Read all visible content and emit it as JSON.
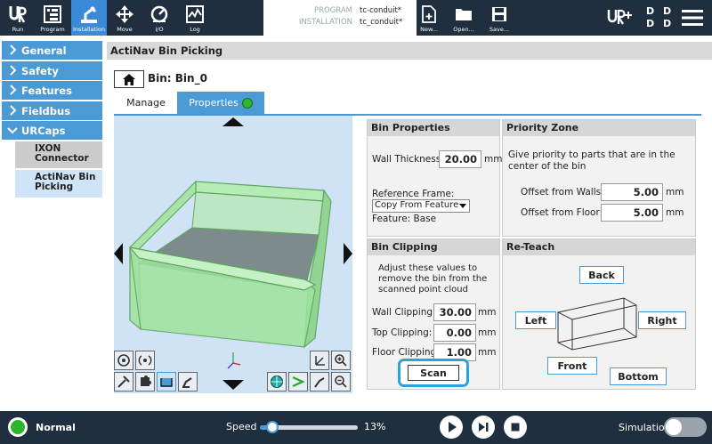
{
  "topbar": {
    "nav": [
      {
        "label": "Run",
        "icon": "ur-logo-icon"
      },
      {
        "label": "Program",
        "icon": "program-icon"
      },
      {
        "label": "Installation",
        "icon": "installation-icon"
      },
      {
        "label": "Move",
        "icon": "move-icon"
      },
      {
        "label": "I/O",
        "icon": "io-icon"
      },
      {
        "label": "Log",
        "icon": "log-icon"
      }
    ],
    "program_key": "PROGRAM",
    "program_value": "tc-conduit*",
    "installation_key": "INSTALLATION",
    "installation_value": "tc_conduit*",
    "file_buttons": [
      {
        "label": "New...",
        "icon": "new-file-icon"
      },
      {
        "label": "Open...",
        "icon": "open-folder-icon"
      },
      {
        "label": "Save...",
        "icon": "save-icon"
      }
    ],
    "dd_glyph": "D D\nD D"
  },
  "sidebar": {
    "items": [
      {
        "label": "General"
      },
      {
        "label": "Safety"
      },
      {
        "label": "Features"
      },
      {
        "label": "Fieldbus"
      },
      {
        "label": "URCaps"
      }
    ],
    "subitems": [
      {
        "label": "IXON Connector",
        "active": false
      },
      {
        "label": "ActiNav Bin Picking",
        "active": true
      }
    ]
  },
  "main": {
    "header": "ActiNav Bin Picking",
    "bin_title": "Bin: Bin_0",
    "tabs": [
      {
        "label": "Manage",
        "active": false
      },
      {
        "label": "Properties",
        "active": true
      }
    ]
  },
  "bin_properties": {
    "title": "Bin Properties",
    "wall_thickness_label": "Wall Thickness:",
    "wall_thickness_value": "20.00",
    "unit": "mm",
    "reference_frame_label": "Reference Frame:",
    "reference_frame_value": "Copy From Feature",
    "feature_label": "Feature: Base"
  },
  "priority_zone": {
    "title": "Priority Zone",
    "description": "Give priority to parts that are in the center of the bin",
    "offset_walls_label": "Offset from Walls:",
    "offset_walls_value": "5.00",
    "offset_floor_label": "Offset from Floor:",
    "offset_floor_value": "5.00",
    "unit": "mm"
  },
  "bin_clipping": {
    "title": "Bin Clipping",
    "description": "Adjust these values to remove the bin from the scanned point cloud",
    "wall_label": "Wall Clipping:",
    "wall_value": "30.00",
    "top_label": "Top Clipping:",
    "top_value": "0.00",
    "floor_label": "Floor Clipping:",
    "floor_value": "1.00",
    "unit": "mm",
    "scan_label": "Scan"
  },
  "reteach": {
    "title": "Re-Teach",
    "back": "Back",
    "left": "Left",
    "right": "Right",
    "front": "Front",
    "bottom": "Bottom"
  },
  "bottombar": {
    "status": "Normal",
    "speed_label": "Speed",
    "speed_value": "13%",
    "speed_fraction": 0.13,
    "simulation_label": "Simulation"
  },
  "colors": {
    "accent": "#4a9ad6",
    "topbar_bg": "#1f2f3f",
    "status_green": "#2db52d",
    "bin_green": "#9fe39f"
  }
}
